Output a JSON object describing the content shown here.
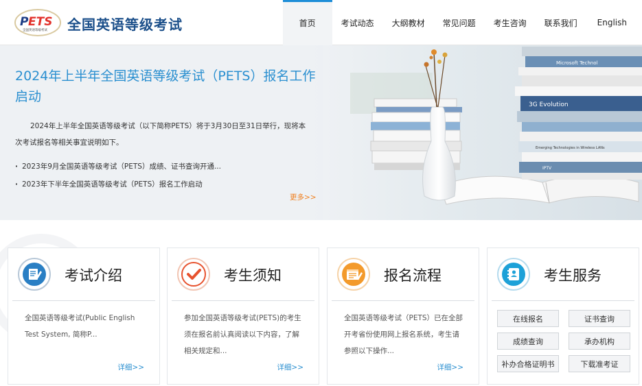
{
  "header": {
    "logo_text": "PETS",
    "logo_subtext": "全国英语等级考试",
    "site_title": "全国英语等级考试"
  },
  "nav": {
    "items": [
      "首页",
      "考试动态",
      "大纲教材",
      "常见问题",
      "考生咨询",
      "联系我们",
      "English"
    ],
    "active_index": 0
  },
  "banner": {
    "title": "2024年上半年全国英语等级考试（PETS）报名工作启动",
    "description": "2024年上半年全国英语等级考试（以下简称PETS）将于3月30日至31日举行，现将本次考试报名等相关事宜说明如下。",
    "news": [
      "2023年9月全国英语等级考试（PETS）成绩、证书查询开通...",
      "2023年下半年全国英语等级考试（PETS）报名工作启动"
    ],
    "more": "更多>>",
    "book_spines": [
      "Microsoft Technol",
      "3G Evolution",
      "Emerging Technologies in Wireless LANs",
      "IPTV"
    ]
  },
  "cards": [
    {
      "title": "考试介绍",
      "text": "全国英语等级考试(Public English Test System, 简称P...",
      "more": "详细>>",
      "icon": "document-pen-icon"
    },
    {
      "title": "考生须知",
      "text": "参加全国英语等级考试(PETS)的考生须在报名前认真阅读以下内容，了解相关规定和...",
      "more": "详细>>",
      "icon": "checkmark-icon"
    },
    {
      "title": "报名流程",
      "text": "全国英语等级考试（PETS）已在全部开考省份使用网上报名系统，考生请参照以下操作...",
      "more": "详细>>",
      "icon": "registration-form-icon"
    },
    {
      "title": "考生服务",
      "icon": "contacts-book-icon",
      "services": [
        "在线报名",
        "证书查询",
        "成绩查询",
        "承办机构",
        "补办合格证明书",
        "下载准考证"
      ]
    }
  ],
  "colors": {
    "accent_blue": "#2a8fd0",
    "accent_orange": "#f0801f",
    "brand_red": "#e2322c",
    "brand_blue": "#1b4f8a"
  }
}
